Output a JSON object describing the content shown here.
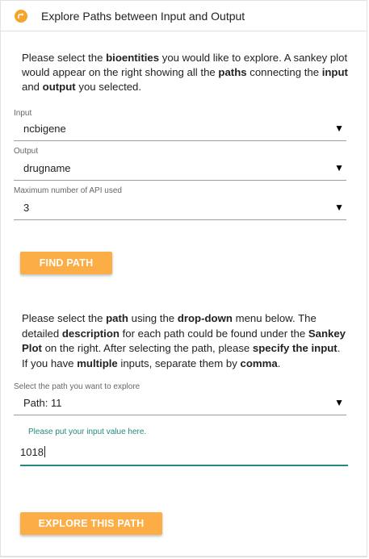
{
  "header": {
    "title": "Explore Paths between Input and Output"
  },
  "intro": {
    "t1": "Please select the ",
    "b1": "bioentities",
    "t2": " you would like to explore. A sankey plot would appear on the right showing all the ",
    "b2": "paths",
    "t3": " connecting the ",
    "b3": "input",
    "t4": " and ",
    "b4": "output",
    "t5": " you selected."
  },
  "input_field": {
    "label": "Input",
    "value": "ncbigene"
  },
  "output_field": {
    "label": "Output",
    "value": "drugname"
  },
  "max_api_field": {
    "label": "Maximum number of API used",
    "value": "3"
  },
  "find_path_button": {
    "label": "FIND PATH"
  },
  "description": {
    "t1": "Please select the ",
    "b1": "path",
    "t2": " using the ",
    "b2": "drop-down",
    "t3": " menu below. The detailed ",
    "b3": "description",
    "t4": " for each path could be found under the ",
    "b4": "Sankey Plot",
    "t5": " on the right. After selecting the path, please ",
    "b5": "specify the input",
    "t6": ". If you have ",
    "b6": "multiple",
    "t7": " inputs, separate them by ",
    "b7": "comma",
    "t8": "."
  },
  "path_field": {
    "label": "Select the path you want to explore",
    "value": "Path: 11"
  },
  "input_value_field": {
    "hint": "Please put your input value here.",
    "value": "1018"
  },
  "explore_button": {
    "label": "EXPLORE THIS PATH"
  },
  "arrow_glyph": "▼",
  "colors": {
    "accent": "#fcad46",
    "icon": "#f5a52c",
    "focus": "#26897d"
  },
  "icons": {
    "header": "route-icon",
    "dropdown": "chevron-down-icon"
  }
}
